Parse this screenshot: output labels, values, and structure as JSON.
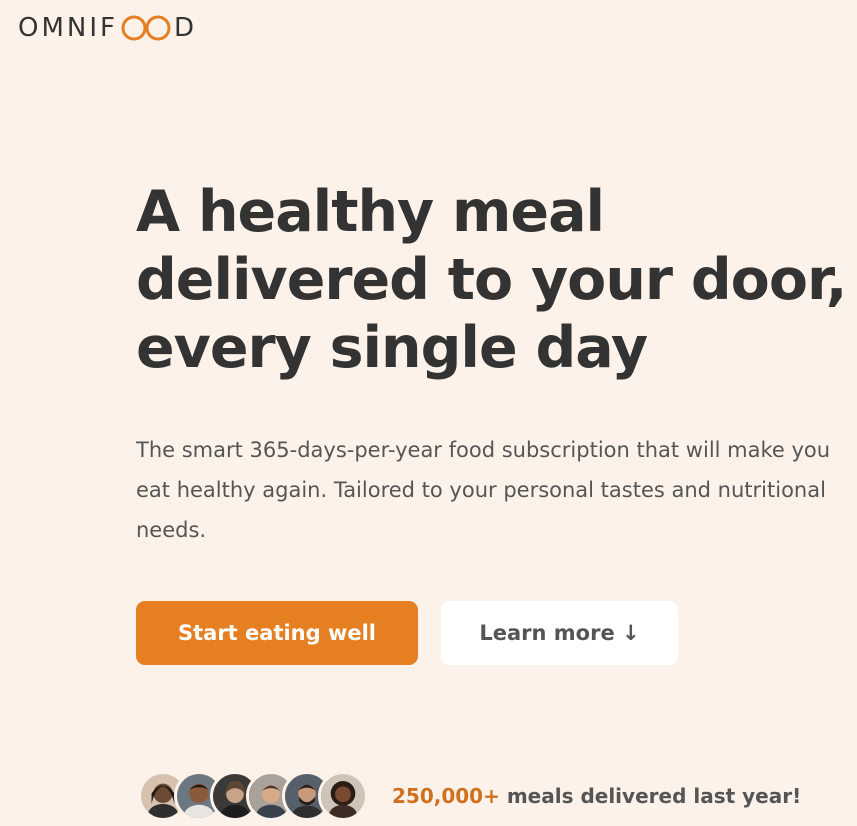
{
  "logo": {
    "text_before": "OMNIF",
    "text_after": "D",
    "loop_icon": "infinity-loop-icon"
  },
  "hero": {
    "heading_lines": [
      "A healthy meal",
      "delivered to your door,",
      "every single day"
    ],
    "description": "The smart 365-days-per-year food subscription that will make you eat healthy again. Tailored to your personal tastes and nutritional needs.",
    "primary_button": "Start eating well",
    "secondary_button": "Learn more ↓"
  },
  "delivered": {
    "count": "250,000+",
    "text": " meals delivered last year!",
    "avatars": [
      "customer-avatar-1",
      "customer-avatar-2",
      "customer-avatar-3",
      "customer-avatar-4",
      "customer-avatar-5",
      "customer-avatar-6"
    ]
  },
  "colors": {
    "background": "#fdf2e9",
    "accent": "#e67e22",
    "accent_text": "#cf711f",
    "text": "#333333",
    "muted_text": "#555555"
  }
}
